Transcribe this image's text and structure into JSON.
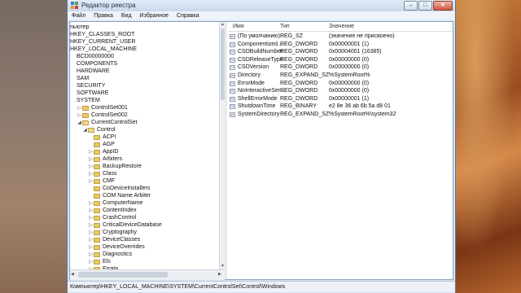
{
  "window": {
    "title": "Редактор реестра"
  },
  "menu": [
    "Файл",
    "Правка",
    "Вид",
    "Избранное",
    "Справка"
  ],
  "tree": {
    "items": [
      {
        "label": "пьютер",
        "indent": 0,
        "expander": "",
        "folder": false
      },
      {
        "label": "HKEY_CLASSES_ROOT",
        "indent": 0,
        "expander": "",
        "folder": false
      },
      {
        "label": "HKEY_CURRENT_USER",
        "indent": 0,
        "expander": "",
        "folder": false
      },
      {
        "label": "HKEY_LOCAL_MACHINE",
        "indent": 0,
        "expander": "",
        "folder": false
      },
      {
        "label": "BCD00000000",
        "indent": 1,
        "expander": "",
        "folder": false
      },
      {
        "label": "COMPONENTS",
        "indent": 1,
        "expander": "",
        "folder": false
      },
      {
        "label": "HARDWARE",
        "indent": 1,
        "expander": "",
        "folder": false
      },
      {
        "label": "SAM",
        "indent": 1,
        "expander": "",
        "folder": false
      },
      {
        "label": "SECURITY",
        "indent": 1,
        "expander": "",
        "folder": false
      },
      {
        "label": "SOFTWARE",
        "indent": 1,
        "expander": "",
        "folder": false
      },
      {
        "label": "SYSTEM",
        "indent": 1,
        "expander": "",
        "folder": false
      },
      {
        "label": "ControlSet001",
        "indent": 2,
        "expander": "▷",
        "folder": true
      },
      {
        "label": "ControlSet002",
        "indent": 2,
        "expander": "▷",
        "folder": true
      },
      {
        "label": "CurrentControlSet",
        "indent": 2,
        "expander": "◢",
        "folder": true
      },
      {
        "label": "Control",
        "indent": 3,
        "expander": "◢",
        "folder": true
      },
      {
        "label": "ACPI",
        "indent": 4,
        "expander": "",
        "folder": true
      },
      {
        "label": "AGP",
        "indent": 4,
        "expander": "",
        "folder": true
      },
      {
        "label": "AppID",
        "indent": 4,
        "expander": "▷",
        "folder": true
      },
      {
        "label": "Arbiters",
        "indent": 4,
        "expander": "▷",
        "folder": true
      },
      {
        "label": "BackupRestore",
        "indent": 4,
        "expander": "▷",
        "folder": true
      },
      {
        "label": "Class",
        "indent": 4,
        "expander": "▷",
        "folder": true
      },
      {
        "label": "CMF",
        "indent": 4,
        "expander": "▷",
        "folder": true
      },
      {
        "label": "CoDeviceInstallers",
        "indent": 4,
        "expander": "",
        "folder": true
      },
      {
        "label": "COM Name Arbiter",
        "indent": 4,
        "expander": "",
        "folder": true
      },
      {
        "label": "ComputerName",
        "indent": 4,
        "expander": "▷",
        "folder": true
      },
      {
        "label": "ContentIndex",
        "indent": 4,
        "expander": "▷",
        "folder": true
      },
      {
        "label": "CrashControl",
        "indent": 4,
        "expander": "▷",
        "folder": true
      },
      {
        "label": "CriticalDeviceDatabase",
        "indent": 4,
        "expander": "▷",
        "folder": true
      },
      {
        "label": "Cryptography",
        "indent": 4,
        "expander": "▷",
        "folder": true
      },
      {
        "label": "DeviceClasses",
        "indent": 4,
        "expander": "▷",
        "folder": true
      },
      {
        "label": "DeviceOverrides",
        "indent": 4,
        "expander": "▷",
        "folder": true
      },
      {
        "label": "Diagnostics",
        "indent": 4,
        "expander": "▷",
        "folder": true
      },
      {
        "label": "Els",
        "indent": 4,
        "expander": "▷",
        "folder": true
      },
      {
        "label": "Errata",
        "indent": 4,
        "expander": "▷",
        "folder": true
      }
    ]
  },
  "values": {
    "headers": {
      "name": "Имя",
      "type": "Тип",
      "data": "Значение"
    },
    "rows": [
      {
        "name": "(По умолчанию)",
        "type": "REG_SZ",
        "data": "(значение не присвоено)",
        "kind": "sz"
      },
      {
        "name": "Componentized...",
        "type": "REG_DWORD",
        "data": "0x00000001 (1)",
        "kind": "bin"
      },
      {
        "name": "CSDBuildNumber",
        "type": "REG_DWORD",
        "data": "0x00004001 (16385)",
        "kind": "bin"
      },
      {
        "name": "CSDReleaseType",
        "type": "REG_DWORD",
        "data": "0x00000000 (0)",
        "kind": "bin"
      },
      {
        "name": "CSDVersion",
        "type": "REG_DWORD",
        "data": "0x00000000 (0)",
        "kind": "bin"
      },
      {
        "name": "Directory",
        "type": "REG_EXPAND_SZ",
        "data": "%SystemRoot%",
        "kind": "sz"
      },
      {
        "name": "ErrorMode",
        "type": "REG_DWORD",
        "data": "0x00000000 (0)",
        "kind": "bin"
      },
      {
        "name": "NoInteractiveSer...",
        "type": "REG_DWORD",
        "data": "0x00000000 (0)",
        "kind": "bin"
      },
      {
        "name": "ShellErrorMode",
        "type": "REG_DWORD",
        "data": "0x00000001 (1)",
        "kind": "bin"
      },
      {
        "name": "ShutdownTime",
        "type": "REG_BINARY",
        "data": "e2 8e 36 ab 6b 5a d8 01",
        "kind": "bin"
      },
      {
        "name": "SystemDirectory",
        "type": "REG_EXPAND_SZ",
        "data": "%SystemRoot%\\system32",
        "kind": "sz"
      }
    ]
  },
  "statusbar": {
    "path": "Компьютер\\HKEY_LOCAL_MACHINE\\SYSTEM\\CurrentControlSet\\Control\\Windows"
  },
  "colors": {
    "window_frame": "#d6e3f2",
    "folder": "#e9c96a"
  }
}
